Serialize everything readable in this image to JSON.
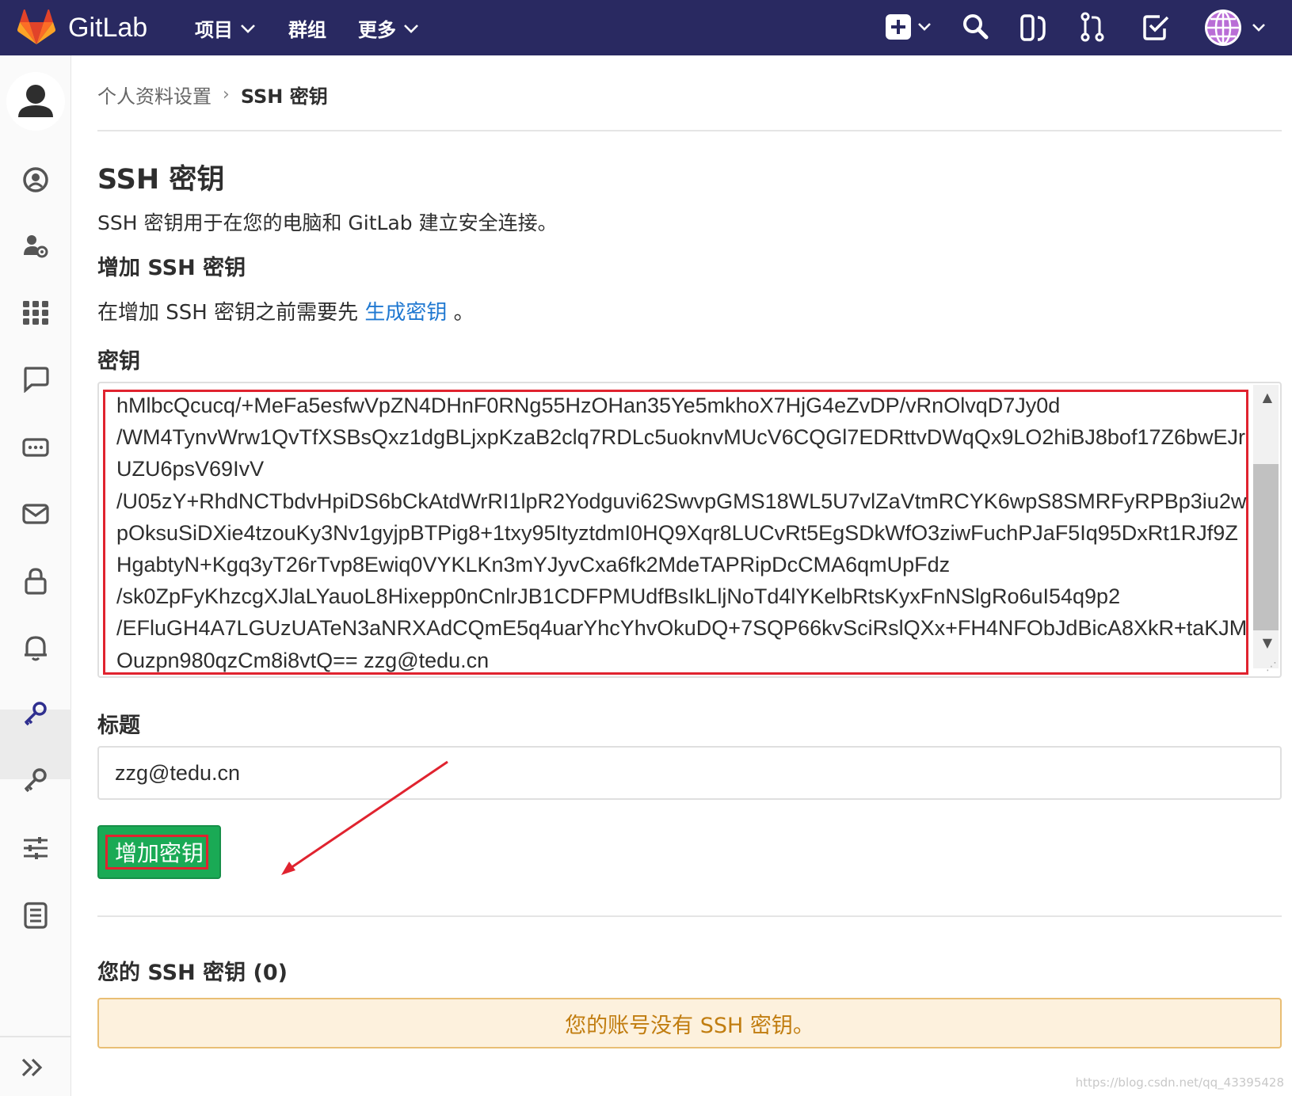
{
  "app": {
    "brand": "GitLab"
  },
  "topnav": {
    "projects": "项目",
    "groups": "群组",
    "more": "更多"
  },
  "breadcrumb": {
    "parent": "个人资料设置",
    "current": "SSH 密钥"
  },
  "page": {
    "title": "SSH 密钥",
    "description": "SSH 密钥用于在您的电脑和 GitLab 建立安全连接。",
    "add_heading": "增加 SSH 密钥",
    "pre_text": "在增加 SSH 密钥之前需要先",
    "generate_link": "生成密钥",
    "pre_text_end": "。",
    "key_label": "密钥",
    "key_value": "hMlbcQcucq/+MeFa5esfwVpZN4DHnF0RNg55HzOHan35Ye5mkhoX7HjG4eZvDP/vRnOlvqD7Jy0d\n/WM4TynvWrw1QvTfXSBsQxz1dgBLjxpKzaB2clq7RDLc5uoknvMUcV6CQGl7EDRttvDWqQx9LO2hiBJ8bof17Z6bwEJr\nUZU6psV69IvV\n/U05zY+RhdNCTbdvHpiDS6bCkAtdWrRI1lpR2Yodguvi62SwvpGMS18WL5U7vlZaVtmRCYK6wpS8SMRFyRPBp3iu2w\npOksuSiDXie4tzouKy3Nv1gyjpBTPig8+1txy95ItyztdmI0HQ9Xqr8LUCvRt5EgSDkWfO3ziwFuchPJaF5Iq95DxRt1RJf9Z\nHgabtyN+Kgq3yT26rTvp8Ewiq0VYKLKn3mYJyvCxa6fk2MdeTAPRipDcCMA6qmUpFdz\n/sk0ZpFyKhzcgXJlaLYauoL8Hixepp0nCnlrJB1CDFPMUdfBsIkLljNoTd4lYKelbRtsKyxFnNSlgRo6uI54q9p2\n/EFluGH4A7LGUzUATeN3aNRXAdCQmE5q4uarYhcYhvOkuDQ+7SQP66kvSciRslQXx+FH4NFObJdBicA8XkR+taKJM\nOuzpn980qzCm8i8vtQ== zzg@tedu.cn",
    "title_label": "标题",
    "title_value": "zzg@tedu.cn",
    "add_button": "增加密钥",
    "your_keys_heading": "您的 SSH 密钥 (0)",
    "no_keys_message": "您的账号没有 SSH 密钥。",
    "watermark": "https://blog.csdn.net/qq_43395428"
  },
  "colors": {
    "nav": "#292961",
    "accent_link": "#1f78d1",
    "button_green": "#1aaa55",
    "highlight_red": "#e0232f",
    "warning_bg": "#fdf1dd"
  },
  "icons": [
    "gitlab-logo-icon",
    "chevron-down-icon",
    "plus-square-icon",
    "search-icon",
    "issues-icon",
    "merge-request-icon",
    "todo-icon",
    "avatar-globe-icon",
    "user-avatar-icon",
    "profile-icon",
    "account-icon",
    "applications-icon",
    "chat-icon",
    "access-tokens-icon",
    "emails-icon",
    "password-icon",
    "notifications-icon",
    "ssh-keys-icon",
    "gpg-keys-icon",
    "preferences-icon",
    "authentication-log-icon",
    "expand-sidebar-icon"
  ]
}
